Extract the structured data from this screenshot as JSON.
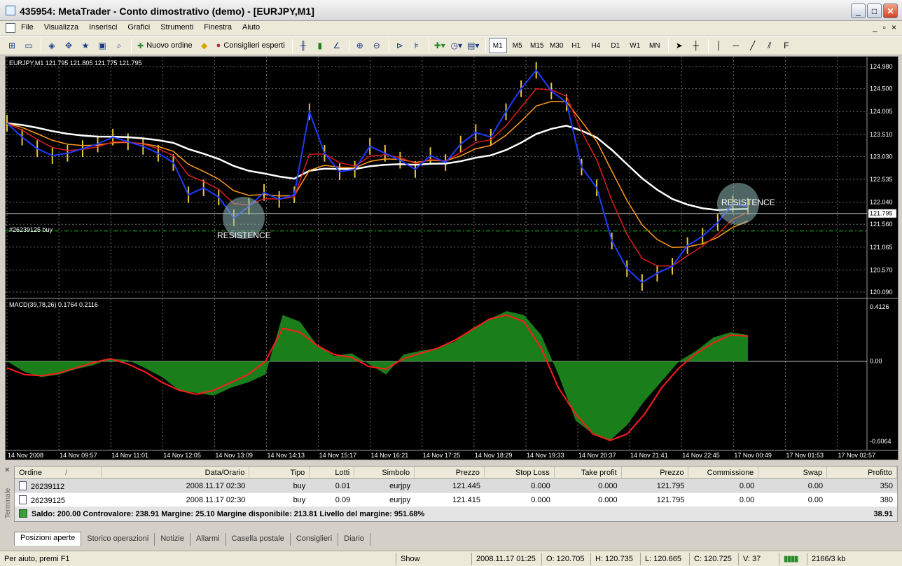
{
  "window": {
    "title": "435954: MetaTrader - Conto dimostrativo (demo) - [EURJPY,M1]",
    "buttons": {
      "minimize": "_",
      "maximize": "□",
      "close": "✕"
    }
  },
  "menu": {
    "items": [
      "File",
      "Visualizza",
      "Inserisci",
      "Grafici",
      "Strumenti",
      "Finestra",
      "Aiuto"
    ],
    "mdi": [
      "_",
      "▫",
      "×"
    ]
  },
  "toolbar": {
    "new_order": "Nuovo ordine",
    "expert_advisors": "Consiglieri esperti",
    "timeframes": [
      "M1",
      "M5",
      "M15",
      "M30",
      "H1",
      "H4",
      "D1",
      "W1",
      "MN"
    ],
    "active_timeframe": "M1"
  },
  "chart": {
    "info": "EURJPY,M1  121.795 121.805 121.775 121.795",
    "order_line_label": "#26239125 buy",
    "annotations": [
      "RESISTENCE",
      "RESISTENCE"
    ],
    "price_axis": [
      "124.980",
      "124.500",
      "124.005",
      "123.510",
      "123.030",
      "122.535",
      "122.040",
      "121.795",
      "121.560",
      "121.065",
      "120.570",
      "120.090"
    ],
    "current_price": "121.795",
    "macd_label": "MACD(39,78,26) 0.1764 0.2116",
    "macd_axis": [
      "0.4126",
      "0.00",
      "-0.6064"
    ],
    "time_axis": [
      "14 Nov 2008",
      "14 Nov 09:57",
      "14 Nov 11:01",
      "14 Nov 12:05",
      "14 Nov 13:09",
      "14 Nov 14:13",
      "14 Nov 15:17",
      "14 Nov 16:21",
      "14 Nov 17:25",
      "14 Nov 18:29",
      "14 Nov 19:33",
      "14 Nov 20:37",
      "14 Nov 21:41",
      "14 Nov 22:45",
      "17 Nov 00:49",
      "17 Nov 01:53",
      "17 Nov 02:57"
    ],
    "colors": {
      "background": "#000000",
      "grid": "#6b6b6b",
      "price": "#1f3cff",
      "bars": "#e8c83a",
      "ma_fast": "#e01b1b",
      "ma_mid": "#ff9a1a",
      "ma_slow": "#ffffff",
      "macd_hist": "#1a7f1a",
      "macd_signal": "#ff1a1a",
      "order_line": "#1fbf1f"
    }
  },
  "chart_data": [
    {
      "type": "line",
      "title": "EURJPY,M1",
      "ylim": [
        120.09,
        124.98
      ],
      "series": [
        {
          "name": "EURJPY",
          "values": [
            123.75,
            123.45,
            123.2,
            123.05,
            123.1,
            123.2,
            123.3,
            123.45,
            123.35,
            123.25,
            123.1,
            122.9,
            122.2,
            122.35,
            122.15,
            121.7,
            121.95,
            122.25,
            122.1,
            122.2,
            124.0,
            123.1,
            122.7,
            122.75,
            123.25,
            123.1,
            122.95,
            122.75,
            123.05,
            122.9,
            123.3,
            123.55,
            123.45,
            124.0,
            124.5,
            124.9,
            124.45,
            124.2,
            122.8,
            122.35,
            121.2,
            120.6,
            120.3,
            120.5,
            120.65,
            121.1,
            121.3,
            121.6,
            122.0,
            121.95
          ]
        }
      ]
    },
    {
      "type": "area",
      "title": "MACD(39,78,26)",
      "ylim": [
        -0.6064,
        0.4126
      ],
      "series": [
        {
          "name": "MACD",
          "values": [
            0.0,
            -0.08,
            -0.12,
            -0.1,
            -0.06,
            -0.03,
            0.02,
            0.01,
            -0.05,
            -0.12,
            -0.22,
            -0.24,
            -0.26,
            -0.2,
            -0.16,
            -0.1,
            0.35,
            0.3,
            0.12,
            0.04,
            0.06,
            -0.02,
            -0.1,
            0.05,
            0.08,
            0.1,
            0.15,
            0.25,
            0.32,
            0.38,
            0.35,
            0.2,
            -0.1,
            -0.45,
            -0.55,
            -0.6,
            -0.48,
            -0.3,
            -0.15,
            0.0,
            0.08,
            0.18,
            0.22,
            0.2
          ]
        },
        {
          "name": "Signal",
          "values": [
            -0.05,
            -0.1,
            -0.11,
            -0.09,
            -0.05,
            -0.01,
            0.02,
            -0.02,
            -0.08,
            -0.16,
            -0.22,
            -0.25,
            -0.22,
            -0.16,
            -0.1,
            0.0,
            0.25,
            0.22,
            0.12,
            0.05,
            0.03,
            -0.04,
            -0.06,
            0.02,
            0.06,
            0.1,
            0.16,
            0.24,
            0.32,
            0.35,
            0.3,
            0.1,
            -0.2,
            -0.4,
            -0.55,
            -0.6,
            -0.55,
            -0.4,
            -0.2,
            -0.05,
            0.06,
            0.14,
            0.2,
            0.19
          ]
        }
      ]
    }
  ],
  "terminal": {
    "side_label": "Terminale",
    "close": "×",
    "headers": [
      "Ordine",
      "Data/Orario",
      "Tipo",
      "Lotti",
      "Simbolo",
      "Prezzo",
      "Stop Loss",
      "Take profit",
      "Prezzo",
      "Commissione",
      "Swap",
      "Profitto"
    ],
    "sort_mark": "/",
    "orders": [
      {
        "ordine": "26239112",
        "data": "2008.11.17 02:30",
        "tipo": "buy",
        "lotti": "0.01",
        "simbolo": "eurjpy",
        "prezzo": "121.445",
        "sl": "0.000",
        "tp": "0.000",
        "prezzo_att": "121.795",
        "commissione": "0.00",
        "swap": "0.00",
        "profitto": "350"
      },
      {
        "ordine": "26239125",
        "data": "2008.11.17 02:30",
        "tipo": "buy",
        "lotti": "0.09",
        "simbolo": "eurjpy",
        "prezzo": "121.415",
        "sl": "0.000",
        "tp": "0.000",
        "prezzo_att": "121.795",
        "commissione": "0.00",
        "swap": "0.00",
        "profitto": "380"
      }
    ],
    "summary": "Saldo: 200.00  Controvalore: 238.91  Margine: 25.10  Margine disponibile: 213.81  Livello del margine: 951.68%",
    "summary_total": "38.91",
    "tabs": [
      "Posizioni aperte",
      "Storico operazioni",
      "Notizie",
      "Allarmi",
      "Casella postale",
      "Consiglieri",
      "Diario"
    ]
  },
  "status": {
    "help": "Per aiuto, premi F1",
    "profile": "Show",
    "datetime": "2008.11.17 01:25",
    "open": "O: 120.705",
    "high": "H: 120.735",
    "low": "L: 120.665",
    "close": "C: 120.725",
    "volume": "V: 37",
    "traffic": "2166/3 kb"
  }
}
